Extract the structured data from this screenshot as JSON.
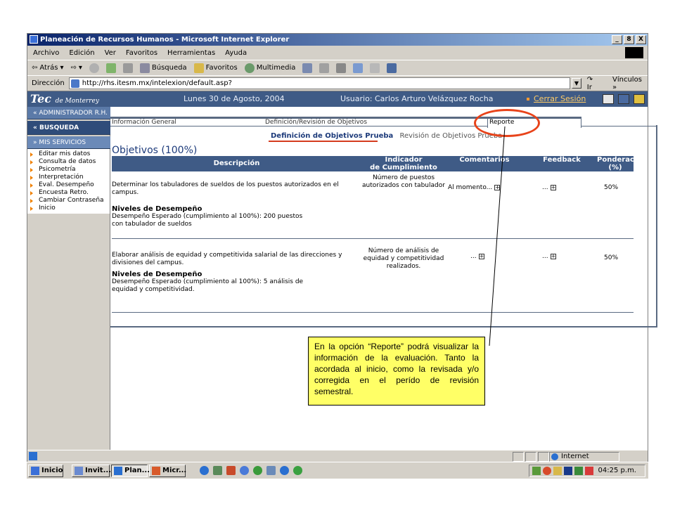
{
  "window": {
    "title": "Planeación de Recursos Humanos - Microsoft Internet Explorer",
    "buttons": [
      "_",
      "8",
      "X"
    ]
  },
  "menu": [
    "Archivo",
    "Edición",
    "Ver",
    "Favoritos",
    "Herramientas",
    "Ayuda"
  ],
  "toolbar": {
    "back": "Atrás",
    "search": "Búsqueda",
    "favorites": "Favoritos",
    "multimedia": "Multimedia"
  },
  "address": {
    "label": "Dirección",
    "url": "http://rhs.itesm.mx/intelexion/default.asp?",
    "go": "Ir",
    "links": "Vínculos"
  },
  "header": {
    "logo_main": "Tec",
    "logo_sub": "de Monterrey",
    "date": "Lunes 30 de Agosto, 2004",
    "user": "Usuario: Carlos Arturo Velázquez Rocha",
    "logout": "Cerrar Sesión"
  },
  "sidebar": {
    "admin": "ADMINISTRADOR R.H.",
    "busqueda": "BUSQUEDA",
    "servicios": "MIS SERVICIOS",
    "items": [
      "Editar mis datos",
      "Consulta de datos",
      "Psicometría",
      "Interpretación",
      "Eval. Desempeño",
      "Encuesta Retro.",
      "Cambiar Contraseña",
      "Inicio"
    ]
  },
  "tabs": [
    "Información General",
    "Definición/Revisión de Objetivos",
    "Reporte"
  ],
  "subtabs": {
    "active": "Definición de Objetivos Prueba",
    "inactive": "Revisión de Objetivos Prueba"
  },
  "section_title": "Objetivos (100%)",
  "table": {
    "headers": {
      "desc": "Descripción",
      "ind1": "Indicador",
      "ind2": "de Cumplimiento",
      "com": "Comentarios",
      "fb": "Feedback",
      "pon1": "Ponderación",
      "pon2": "(%)"
    },
    "rows": [
      {
        "desc": "Determinar los tabuladores de sueldos de los puestos autorizados en el campus.",
        "levels_title": "Niveles de Desempeño",
        "levels": "Desempeño Esperado (cumplimiento al 100%): 200 puestos con tabulador de sueldos",
        "indicator": "Número de puestos autorizados con tabulador",
        "comment": "Al momento...",
        "feedback": "...",
        "weight": "50%"
      },
      {
        "desc": "Elaborar análisis de equidad y competitivida salarial de las direcciones y divisiones del campus.",
        "levels_title": "Niveles de Desempeño",
        "levels": "Desempeño Esperado (cumplimiento al 100%): 5 análisis de equidad y competitividad.",
        "indicator": "Número de análisis de equidad y competitividad realizados.",
        "comment": "...",
        "feedback": "...",
        "weight": "50%"
      }
    ]
  },
  "callout": "En la opción “Reporte” podrá visualizar la información de la evaluación. Tanto la acordada al inicio, como la revisada y/o corregida en el perído de revisión semestral.",
  "status": {
    "zone": "Internet"
  },
  "taskbar": {
    "start": "Inicio",
    "items": [
      "Invit...",
      "Plan...",
      "Micr..."
    ],
    "clock": "04:25 p.m."
  },
  "colors": {
    "header_bg": "#3f5b86",
    "accent_red": "#e8431a",
    "callout_bg": "#ffff66"
  }
}
